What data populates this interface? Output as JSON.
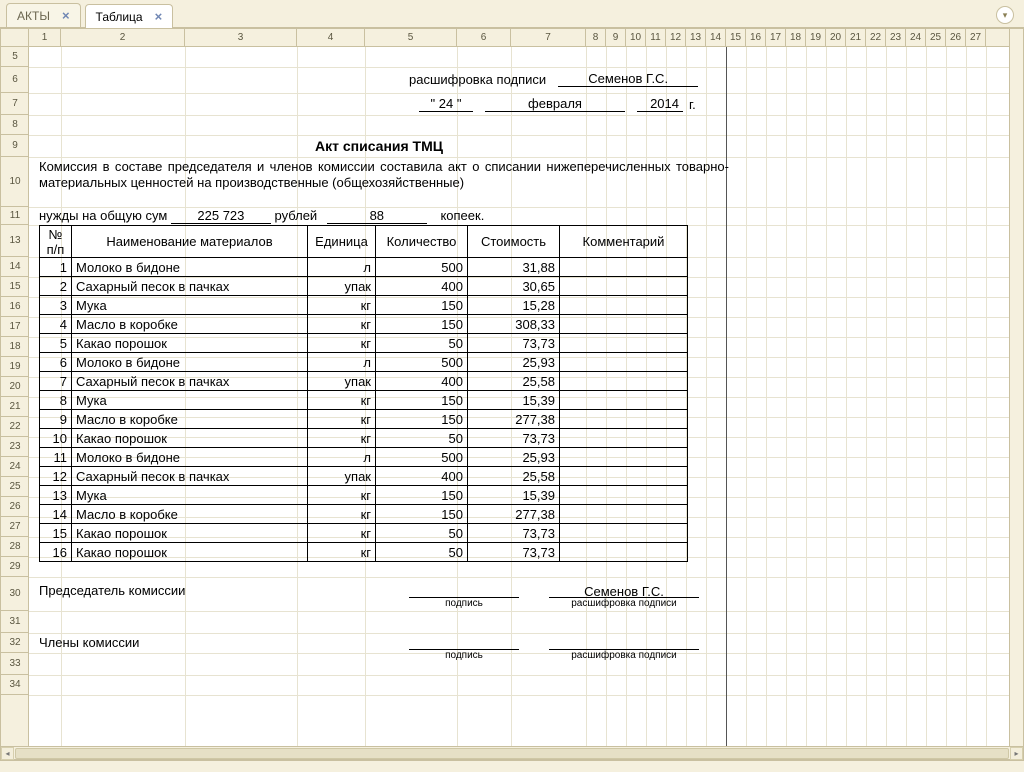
{
  "tabs": [
    {
      "label": "АКТЫ",
      "active": false
    },
    {
      "label": "Таблица",
      "active": true
    }
  ],
  "columns": {
    "labels": [
      "1",
      "2",
      "3",
      "4",
      "5",
      "6",
      "7",
      "8",
      "9",
      "10",
      "11",
      "12",
      "13",
      "14",
      "15",
      "16",
      "17",
      "18",
      "19",
      "20",
      "21",
      "22",
      "23",
      "24",
      "25",
      "26",
      "27"
    ],
    "widths": [
      32,
      124,
      112,
      68,
      92,
      54,
      75,
      20,
      20,
      20,
      20,
      20,
      20,
      20,
      20,
      20,
      20,
      20,
      20,
      20,
      20,
      20,
      20,
      20,
      20,
      20,
      20
    ]
  },
  "pagebreak_after_col": 14,
  "rows": {
    "labels": [
      "5",
      "6",
      "7",
      "8",
      "9",
      "10",
      "11",
      "13",
      "14",
      "15",
      "16",
      "17",
      "18",
      "19",
      "20",
      "21",
      "22",
      "23",
      "24",
      "25",
      "26",
      "27",
      "28",
      "29",
      "30",
      "31",
      "32",
      "33",
      "34"
    ],
    "heights": [
      20,
      26,
      22,
      20,
      22,
      50,
      18,
      32,
      20,
      20,
      20,
      20,
      20,
      20,
      20,
      20,
      20,
      20,
      20,
      20,
      20,
      20,
      20,
      20,
      34,
      22,
      20,
      22,
      20
    ]
  },
  "header_signature": {
    "label": "расшифровка подписи",
    "name": "Семенов Г.С."
  },
  "date_line": {
    "day_q1": "\" 24 \"",
    "month": "февраля",
    "year": "2014",
    "year_suffix": "г."
  },
  "title": "Акт списания ТМЦ",
  "paragraph": "Комиссия в составе председателя и членов комиссии составила акт о списании нижеперечисленных товарно-материальных ценностей на производственные (общехозяйственные)",
  "sumline": {
    "prefix": "нужды  на общую сум",
    "amount_rub": "225 723",
    "rub_label": "рублей",
    "amount_kop": "88",
    "kop_label": "копеек."
  },
  "table": {
    "headers": {
      "pp": "№ п/п",
      "name": "Наименование материалов",
      "unit": "Единица",
      "qty": "Количество",
      "cost": "Стоимость",
      "comment": "Комментарий"
    },
    "rows": [
      {
        "pp": "1",
        "name": "Молоко в бидоне",
        "unit": "л",
        "qty": "500",
        "cost": "31,88",
        "comment": ""
      },
      {
        "pp": "2",
        "name": "Сахарный песок в пачках",
        "unit": "упак",
        "qty": "400",
        "cost": "30,65",
        "comment": ""
      },
      {
        "pp": "3",
        "name": "Мука",
        "unit": "кг",
        "qty": "150",
        "cost": "15,28",
        "comment": ""
      },
      {
        "pp": "4",
        "name": "Масло в коробке",
        "unit": "кг",
        "qty": "150",
        "cost": "308,33",
        "comment": ""
      },
      {
        "pp": "5",
        "name": "Какао порошок",
        "unit": "кг",
        "qty": "50",
        "cost": "73,73",
        "comment": ""
      },
      {
        "pp": "6",
        "name": "Молоко в бидоне",
        "unit": "л",
        "qty": "500",
        "cost": "25,93",
        "comment": ""
      },
      {
        "pp": "7",
        "name": "Сахарный песок в пачках",
        "unit": "упак",
        "qty": "400",
        "cost": "25,58",
        "comment": ""
      },
      {
        "pp": "8",
        "name": "Мука",
        "unit": "кг",
        "qty": "150",
        "cost": "15,39",
        "comment": ""
      },
      {
        "pp": "9",
        "name": "Масло в коробке",
        "unit": "кг",
        "qty": "150",
        "cost": "277,38",
        "comment": ""
      },
      {
        "pp": "10",
        "name": "Какао порошок",
        "unit": "кг",
        "qty": "50",
        "cost": "73,73",
        "comment": ""
      },
      {
        "pp": "11",
        "name": "Молоко в бидоне",
        "unit": "л",
        "qty": "500",
        "cost": "25,93",
        "comment": ""
      },
      {
        "pp": "12",
        "name": "Сахарный песок в пачках",
        "unit": "упак",
        "qty": "400",
        "cost": "25,58",
        "comment": ""
      },
      {
        "pp": "13",
        "name": "Мука",
        "unit": "кг",
        "qty": "150",
        "cost": "15,39",
        "comment": ""
      },
      {
        "pp": "14",
        "name": "Масло в коробке",
        "unit": "кг",
        "qty": "150",
        "cost": "277,38",
        "comment": ""
      },
      {
        "pp": "15",
        "name": "Какао порошок",
        "unit": "кг",
        "qty": "50",
        "cost": "73,73",
        "comment": ""
      },
      {
        "pp": "16",
        "name": "Какао порошок",
        "unit": "кг",
        "qty": "50",
        "cost": "73,73",
        "comment": ""
      }
    ]
  },
  "signatures": {
    "chairman_label": "Председатель комиссии",
    "members_label": "Члены комиссии",
    "signature_small": "подпись",
    "decipher_small": "расшифровка подписи",
    "chairman_name": "Семенов Г.С."
  }
}
